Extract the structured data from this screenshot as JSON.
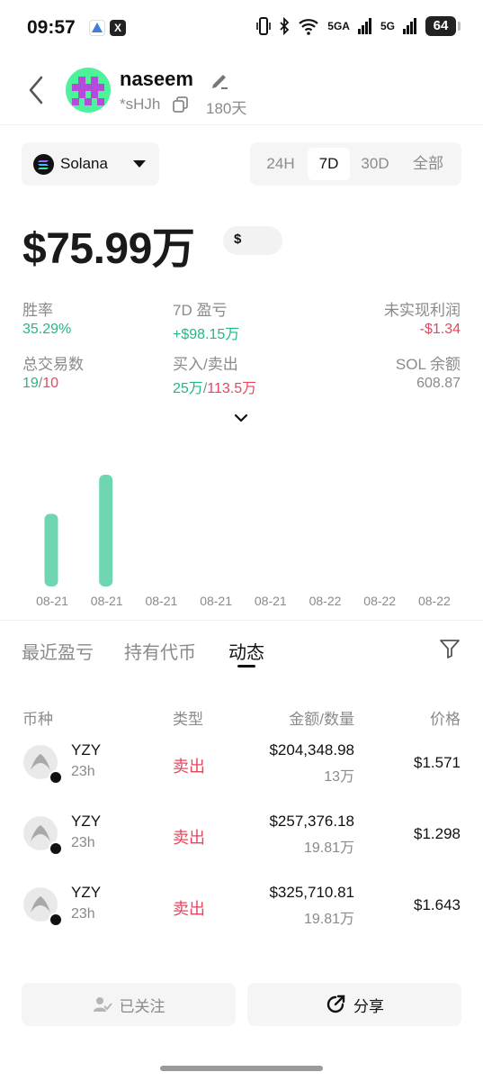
{
  "status_bar": {
    "time": "09:57",
    "app_icons": [
      "app-icon",
      "x-icon"
    ],
    "x_glyph": "X",
    "network_5ga": "5GA",
    "network_5g": "5G",
    "battery": "64"
  },
  "header": {
    "username": "naseem",
    "address": "*sHJh",
    "days": "180天"
  },
  "chain": {
    "label": "Solana"
  },
  "period_tabs": [
    "24H",
    "7D",
    "30D",
    "全部"
  ],
  "period_selected": "7D",
  "balance": {
    "value": "$75.99万",
    "currency_symbol": "$"
  },
  "stats": {
    "win_rate_label": "胜率",
    "win_rate_value": "35.29%",
    "pnl_label": "7D 盈亏",
    "pnl_value": "+$98.15万",
    "unrealized_label": "未实现利润",
    "unrealized_value": "-$1.34",
    "trades_label": "总交易数",
    "trades_buy": "19",
    "trades_sep": "/",
    "trades_sell": "10",
    "buysell_label": "买入/卖出",
    "buy_value": "25万",
    "buysell_sep": "/",
    "sell_value": "113.5万",
    "sol_label": "SOL 余额",
    "sol_value": "608.87"
  },
  "chart_data": {
    "type": "bar",
    "categories": [
      "08-21",
      "08-21",
      "08-21",
      "08-21",
      "08-21",
      "08-22",
      "08-22",
      "08-22"
    ],
    "values": [
      0.65,
      1.0,
      0,
      0,
      0,
      0,
      0,
      0
    ],
    "color": "#6fd6b1"
  },
  "section_tabs": [
    "最近盈亏",
    "持有代币",
    "动态"
  ],
  "section_selected": "动态",
  "table": {
    "headers": {
      "token": "币种",
      "type": "类型",
      "amount": "金额/数量",
      "price": "价格"
    },
    "rows": [
      {
        "token": "YZY",
        "age": "23h",
        "type": "卖出",
        "amount": "$204,348.98",
        "quantity": "13万",
        "price": "$1.571"
      },
      {
        "token": "YZY",
        "age": "23h",
        "type": "卖出",
        "amount": "$257,376.18",
        "quantity": "19.81万",
        "price": "$1.298"
      },
      {
        "token": "YZY",
        "age": "23h",
        "type": "卖出",
        "amount": "$325,710.81",
        "quantity": "19.81万",
        "price": "$1.643"
      }
    ]
  },
  "buttons": {
    "followed": "已关注",
    "share": "分享"
  },
  "colors": {
    "green": "#1fb984",
    "red": "#e8455e",
    "bar": "#6fd6b1"
  }
}
